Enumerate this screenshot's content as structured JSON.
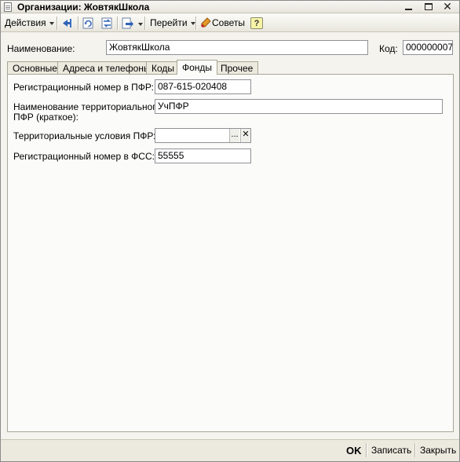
{
  "window": {
    "title": "Организации: ЖовтякШкола"
  },
  "toolbar": {
    "actions_label": "Действия",
    "goto_label": "Перейти",
    "tips_label": "Советы",
    "help_label": "?"
  },
  "header": {
    "name_label": "Наименование:",
    "name_value": "ЖовтякШкола",
    "code_label": "Код:",
    "code_value": "000000007"
  },
  "tabs": [
    {
      "label": "Основные"
    },
    {
      "label": "Адреса и телефоны"
    },
    {
      "label": "Коды"
    },
    {
      "label": "Фонды",
      "active": true
    },
    {
      "label": "Прочее"
    }
  ],
  "funds": {
    "pfr_reg_label": "Регистрационный номер в ПФР:",
    "pfr_reg_value": "087-615-020408",
    "pfr_territory_name_label_line1": "Наименование территориального",
    "pfr_territory_name_label_line2": "ПФР (краткое):",
    "pfr_territory_name_value": "УчПФР",
    "pfr_conditions_label": "Территориальные условия ПФР:",
    "pfr_conditions_value": "",
    "pfr_conditions_select": "...",
    "pfr_conditions_clear": "✕",
    "fss_reg_label": "Регистрационный номер в ФСС:",
    "fss_reg_value": "55555"
  },
  "footer": {
    "ok_label": "OK",
    "save_label": "Записать",
    "close_label": "Закрыть"
  },
  "colors": {
    "window_bg": "#f4f3ee",
    "panel_bg": "#fbfbf9",
    "border": "#a8a696"
  },
  "icons": [
    "document-icon",
    "back-arrow-icon",
    "refresh-icon",
    "switch-icon",
    "report-icon",
    "tips-icon",
    "help-icon"
  ]
}
